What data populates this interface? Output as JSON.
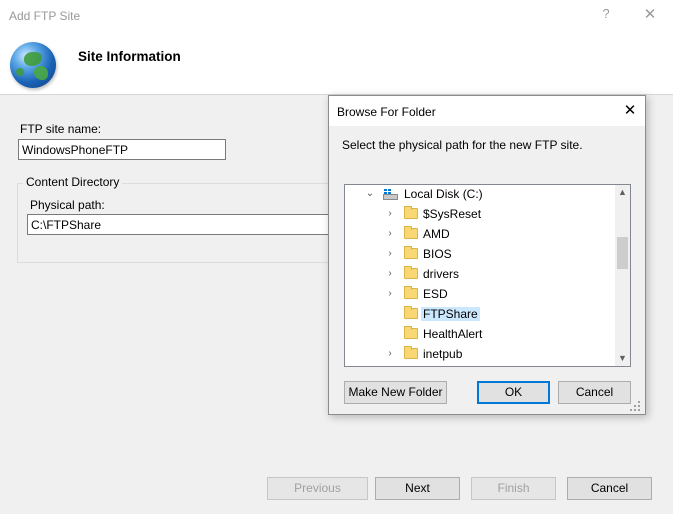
{
  "window": {
    "title": "Add FTP Site",
    "help_glyph": "?",
    "close_glyph": "✕"
  },
  "header": {
    "title": "Site Information"
  },
  "form": {
    "site_name_label": "FTP site name:",
    "site_name_value": "WindowsPhoneFTP",
    "content_directory_label": "Content Directory",
    "physical_path_label": "Physical path:",
    "physical_path_value": "C:\\FTPShare"
  },
  "wizard_buttons": {
    "previous": "Previous",
    "next": "Next",
    "finish": "Finish",
    "cancel": "Cancel"
  },
  "browse_dialog": {
    "title": "Browse For Folder",
    "close_glyph": "✕",
    "description": "Select the physical path for the new FTP site.",
    "tree": {
      "root": "Local Disk (C:)",
      "items": [
        {
          "label": "$SysReset",
          "expandable": true
        },
        {
          "label": "AMD",
          "expandable": true
        },
        {
          "label": "BIOS",
          "expandable": true
        },
        {
          "label": "drivers",
          "expandable": true
        },
        {
          "label": "ESD",
          "expandable": true
        },
        {
          "label": "FTPShare",
          "expandable": false,
          "selected": true
        },
        {
          "label": "HealthAlert",
          "expandable": false
        },
        {
          "label": "inetpub",
          "expandable": true
        }
      ]
    },
    "buttons": {
      "make_new_folder": "Make New Folder",
      "ok": "OK",
      "cancel": "Cancel"
    }
  },
  "colors": {
    "selection": "#cce8ff",
    "default_button_border": "#0078d7",
    "folder": "#f8d775"
  }
}
